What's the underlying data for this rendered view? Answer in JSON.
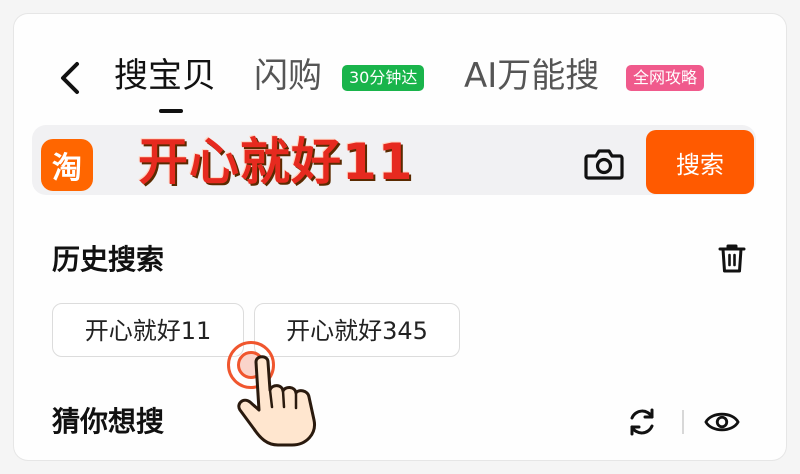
{
  "tabs": [
    {
      "label": "搜宝贝",
      "active": true
    },
    {
      "label": "闪购",
      "badge": "30分钟达"
    },
    {
      "label": "AI万能搜",
      "badge": "全网攻略"
    }
  ],
  "search": {
    "logo_text": "淘",
    "query": "开心就好11",
    "button_label": "搜索"
  },
  "history": {
    "title": "历史搜索",
    "items": [
      "开心就好11",
      "开心就好345"
    ]
  },
  "guess": {
    "title": "猜你想搜"
  },
  "colors": {
    "accent": "#ff5a00",
    "green_badge": "#19b44b",
    "pink_badge": "#f05a8c",
    "query_red": "#e62a1f"
  },
  "icons": [
    "back-arrow-icon",
    "camera-icon",
    "trash-icon",
    "refresh-icon",
    "eye-icon",
    "pointing-hand-icon"
  ]
}
